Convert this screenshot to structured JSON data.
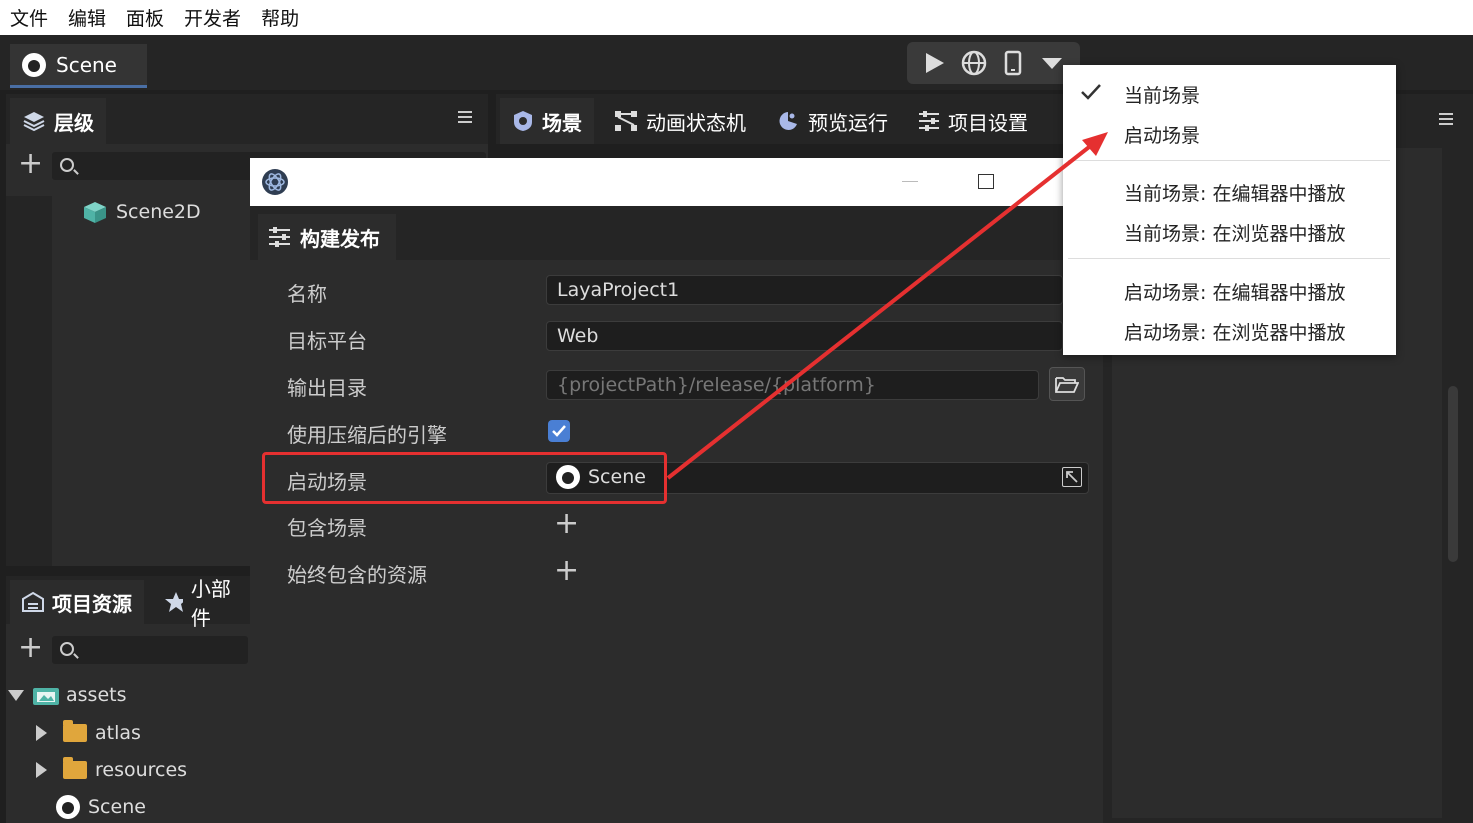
{
  "menubar": {
    "items": [
      "文件",
      "编辑",
      "面板",
      "开发者",
      "帮助"
    ]
  },
  "scene_tab": {
    "label": "Scene"
  },
  "hierarchy": {
    "tab_label": "层级",
    "tree": [
      {
        "label": "Scene2D"
      }
    ]
  },
  "assets": {
    "tabs": [
      "项目资源",
      "小部件"
    ],
    "tree": [
      {
        "label": "assets"
      },
      {
        "label": "atlas"
      },
      {
        "label": "resources"
      },
      {
        "label": "Scene"
      }
    ]
  },
  "center_tabs": [
    "场景",
    "动画状态机",
    "预览运行",
    "项目设置"
  ],
  "dialog": {
    "tab_label": "构建发布",
    "fields": {
      "name_label": "名称",
      "name_value": "LayaProject1",
      "platform_label": "目标平台",
      "platform_value": "Web",
      "output_label": "输出目录",
      "output_placeholder": "{projectPath}/release/{platform}",
      "compress_label": "使用压缩后的引擎",
      "compress_checked": true,
      "start_scene_label": "启动场景",
      "start_scene_value": "Scene",
      "include_scenes_label": "包含场景",
      "always_include_label": "始终包含的资源"
    }
  },
  "popup_menu": {
    "items": [
      {
        "label": "当前场景",
        "checked": true
      },
      {
        "label": "启动场景",
        "checked": false
      },
      {
        "label": "当前场景: 在编辑器中播放"
      },
      {
        "label": "当前场景: 在浏览器中播放"
      },
      {
        "label": "启动场景: 在编辑器中播放"
      },
      {
        "label": "启动场景: 在浏览器中播放"
      }
    ]
  },
  "colors": {
    "accent": "#4a7fd4",
    "highlight": "#e53030",
    "panel": "#2c2c2c"
  }
}
